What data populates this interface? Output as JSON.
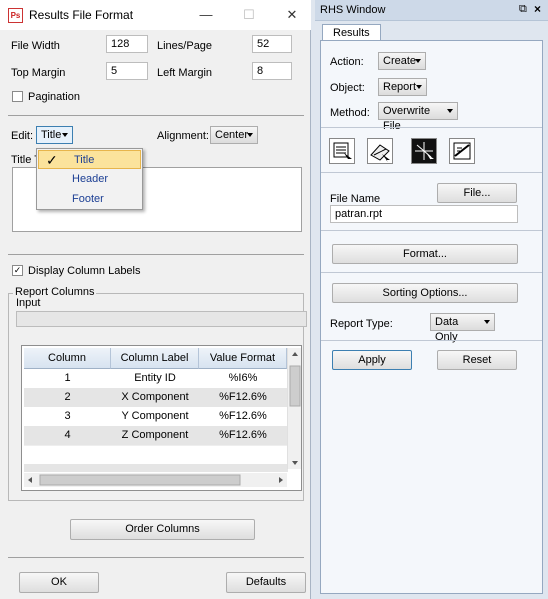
{
  "dialog": {
    "title": "Results File Format",
    "app_icon_text": "Ps",
    "minimize": "—",
    "maximize": "☐",
    "close": "✕",
    "file_width_label": "File Width",
    "file_width_value": "128",
    "lines_page_label": "Lines/Page",
    "lines_page_value": "52",
    "top_margin_label": "Top Margin",
    "top_margin_value": "5",
    "left_margin_label": "Left Margin",
    "left_margin_value": "8",
    "pagination_label": "Pagination",
    "pagination_checked": false,
    "edit_label": "Edit:",
    "edit_value": "Title",
    "edit_menu": [
      "Title",
      "Header",
      "Footer"
    ],
    "edit_menu_selected": "Title",
    "alignment_label": "Alignment:",
    "alignment_value": "Center",
    "title_text_label": "Title Te",
    "title_text_value": "",
    "display_column_labels_label": "Display Column Labels",
    "display_column_labels_checked": true,
    "report_columns_label": "Report Columns",
    "input_label": "Input",
    "table": {
      "headers": [
        "Column",
        "Column Label",
        "Value Format"
      ],
      "rows": [
        [
          "1",
          "Entity ID",
          "%I6%"
        ],
        [
          "2",
          "X Component",
          "%F12.6%"
        ],
        [
          "3",
          "Y Component",
          "%F12.6%"
        ],
        [
          "4",
          "Z Component",
          "%F12.6%"
        ]
      ]
    },
    "order_columns_button": "Order Columns",
    "ok_button": "OK",
    "defaults_button": "Defaults"
  },
  "rhs": {
    "title": "RHS Window",
    "tab_label": "Results",
    "action_label": "Action:",
    "action_value": "Create",
    "object_label": "Object:",
    "object_value": "Report",
    "method_label": "Method:",
    "method_value": "Overwrite File",
    "file_name_label": "File Name",
    "file_button": "File...",
    "file_name_value": "patran.rpt",
    "format_button": "Format...",
    "sorting_button": "Sorting Options...",
    "report_type_label": "Report Type:",
    "report_type_value": "Data Only",
    "apply_button": "Apply",
    "reset_button": "Reset"
  },
  "colors": {
    "accent": "#1c3f94",
    "selection": "#fbe39c",
    "header_gradient_top": "#eef3f9"
  }
}
